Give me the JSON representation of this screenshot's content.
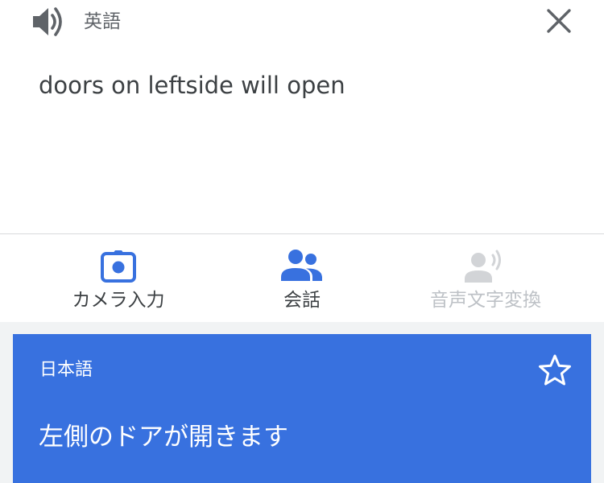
{
  "source": {
    "language_label": "英語",
    "text": "doors on leftside will open",
    "speaker_icon": "speaker-icon",
    "close_icon": "close-icon"
  },
  "tools": [
    {
      "label": "カメラ入力",
      "icon": "camera-icon",
      "enabled": true
    },
    {
      "label": "会話",
      "icon": "conversation-icon",
      "enabled": true
    },
    {
      "label": "音声文字変換",
      "icon": "transcribe-icon",
      "enabled": false
    }
  ],
  "result": {
    "language_label": "日本語",
    "text": "左側のドアが開きます",
    "star_icon": "star-outline-icon"
  },
  "colors": {
    "accent_blue": "#3871df",
    "icon_grey": "#5f6368",
    "disabled_grey": "#bdc1c6",
    "text_dark": "#3c4043",
    "band_grey": "#f1f3f4"
  }
}
